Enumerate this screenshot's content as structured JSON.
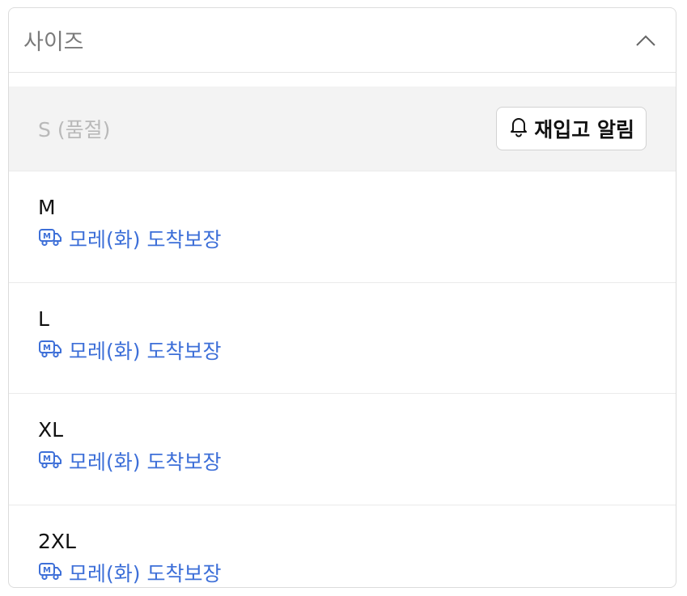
{
  "dropdown": {
    "label": "사이즈",
    "expanded": true,
    "accent_color": "#3d6fd8",
    "options": [
      {
        "name": "S (품절)",
        "sold_out": true,
        "action_label": "재입고 알림",
        "action_icon": "bell-icon"
      },
      {
        "name": "M",
        "delivery": "모레(화) 도착보장",
        "delivery_icon": "delivery-truck-icon"
      },
      {
        "name": "L",
        "delivery": "모레(화) 도착보장",
        "delivery_icon": "delivery-truck-icon"
      },
      {
        "name": "XL",
        "delivery": "모레(화) 도착보장",
        "delivery_icon": "delivery-truck-icon"
      },
      {
        "name": "2XL",
        "delivery": "모레(화) 도착보장",
        "delivery_icon": "delivery-truck-icon"
      }
    ]
  }
}
